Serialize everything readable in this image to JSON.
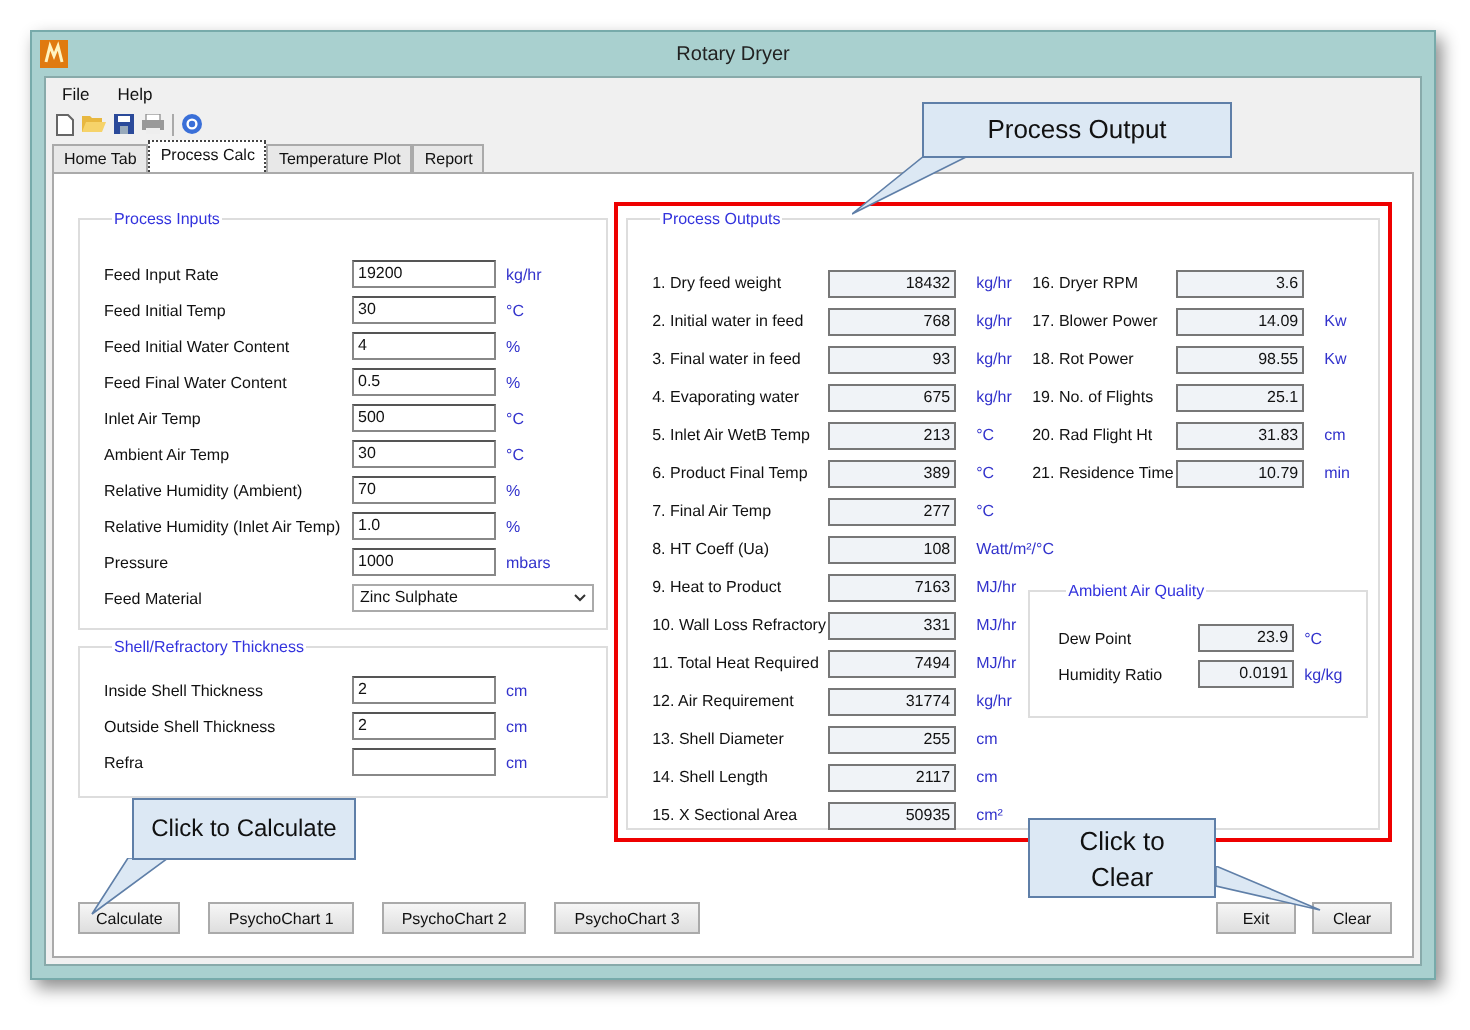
{
  "window": {
    "title": "Rotary Dryer"
  },
  "menu": [
    {
      "label": "File"
    },
    {
      "label": "Help"
    }
  ],
  "tabs": [
    {
      "label": "Home Tab",
      "selected": false
    },
    {
      "label": "Process Calc",
      "selected": true
    },
    {
      "label": "Temperature Plot",
      "selected": false
    },
    {
      "label": "Report",
      "selected": false
    }
  ],
  "process_inputs": {
    "title": "Process Inputs",
    "rows": [
      {
        "kind": "field",
        "label": "Feed Input Rate",
        "value": "19200",
        "unit": "kg/hr"
      },
      {
        "kind": "field",
        "label": "Feed Initial Temp",
        "value": "30",
        "unit": "°C"
      },
      {
        "kind": "field",
        "label": "Feed Initial Water Content",
        "value": "4",
        "unit": "%"
      },
      {
        "kind": "field",
        "label": "Feed Final Water Content",
        "value": "0.5",
        "unit": "%"
      },
      {
        "kind": "field",
        "label": "Inlet Air Temp",
        "value": "500",
        "unit": "°C"
      },
      {
        "kind": "field",
        "label": "Ambient Air Temp",
        "value": "30",
        "unit": "°C"
      },
      {
        "kind": "field",
        "label": "Relative Humidity (Ambient)",
        "value": "70",
        "unit": "%"
      },
      {
        "kind": "field",
        "label": "Relative Humidity (Inlet Air Temp)",
        "value": "1.0",
        "unit": "%"
      },
      {
        "kind": "field",
        "label": "Pressure",
        "value": "1000",
        "unit": "mbars"
      },
      {
        "kind": "dropdown",
        "label": "Feed Material",
        "value": "Zinc Sulphate"
      }
    ]
  },
  "shell": {
    "title": "Shell/Refractory Thickness",
    "rows": [
      {
        "label": "Inside Shell Thickness",
        "value": "2",
        "unit": "cm"
      },
      {
        "label": "Outside Shell Thickness",
        "value": "2",
        "unit": "cm"
      },
      {
        "label": "Refra",
        "unit": "cm"
      }
    ]
  },
  "process_outputs": {
    "title": "Process Outputs",
    "left": [
      {
        "label": "1. Dry feed weight",
        "value": "18432",
        "unit": "kg/hr"
      },
      {
        "label": "2. Initial water in feed",
        "value": "768",
        "unit": "kg/hr"
      },
      {
        "label": "3. Final water in feed",
        "value": "93",
        "unit": "kg/hr"
      },
      {
        "label": "4. Evaporating water",
        "value": "675",
        "unit": "kg/hr"
      },
      {
        "label": "5. Inlet Air WetB Temp",
        "value": "213",
        "unit": "°C"
      },
      {
        "label": "6. Product Final Temp",
        "value": "389",
        "unit": "°C"
      },
      {
        "label": "7. Final Air Temp",
        "value": "277",
        "unit": "°C"
      },
      {
        "label": "8. HT Coeff (Ua)",
        "value": "108",
        "unit": "Watt/m²/°C"
      },
      {
        "label": "9. Heat to Product",
        "value": "7163",
        "unit": "MJ/hr"
      },
      {
        "label": "10. Wall Loss Refractory",
        "value": "331",
        "unit": "MJ/hr"
      },
      {
        "label": "11. Total Heat Required",
        "value": "7494",
        "unit": "MJ/hr"
      },
      {
        "label": "12. Air Requirement",
        "value": "31774",
        "unit": "kg/hr"
      },
      {
        "label": "13. Shell Diameter",
        "value": "255",
        "unit": "cm"
      },
      {
        "label": "14. Shell Length",
        "value": "2117",
        "unit": "cm"
      },
      {
        "label": "15. X Sectional Area",
        "value": "50935",
        "unit": "cm²"
      }
    ],
    "right": [
      {
        "label": "16. Dryer RPM",
        "value": "3.6"
      },
      {
        "label": "17. Blower Power",
        "value": "14.09",
        "unit": "Kw"
      },
      {
        "label": "18. Rot Power",
        "value": "98.55",
        "unit": "Kw"
      },
      {
        "label": "19. No. of Flights",
        "value": "25.1"
      },
      {
        "label": "20. Rad Flight Ht",
        "value": "31.83",
        "unit": "cm"
      },
      {
        "label": "21. Residence Time",
        "value": "10.79",
        "unit": "min"
      }
    ],
    "ambient": {
      "title": "Ambient Air Quality",
      "rows": [
        {
          "label": "Dew Point",
          "value": "23.9",
          "unit": "°C"
        },
        {
          "label": "Humidity Ratio",
          "value": "0.0191",
          "unit": "kg/kg"
        }
      ]
    }
  },
  "buttons_left": [
    "Calculate",
    "PsychoChart 1",
    "PsychoChart 2",
    "PsychoChart 3"
  ],
  "buttons_right": [
    "Exit",
    "Clear"
  ],
  "callouts": [
    {
      "text": "Process Output"
    },
    {
      "text": "Click to Calculate"
    },
    {
      "text": "Click to Clear"
    }
  ]
}
